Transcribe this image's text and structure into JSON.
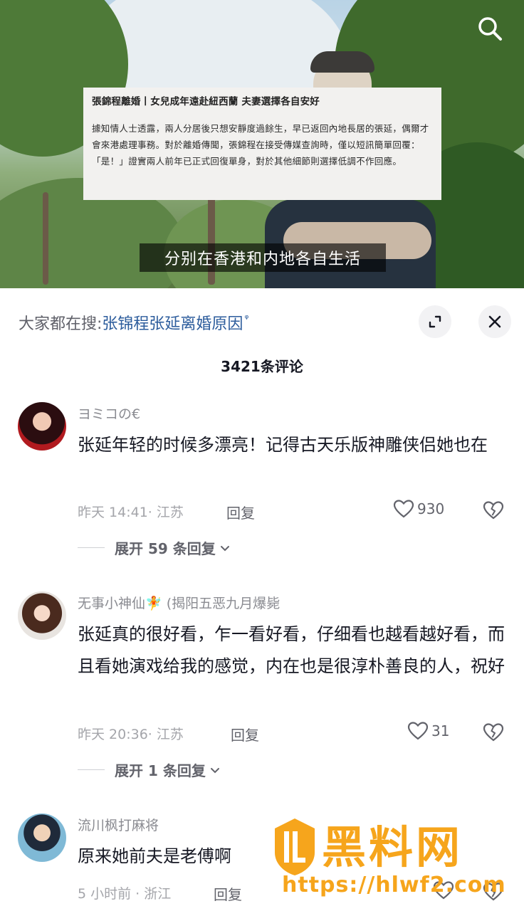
{
  "video": {
    "news_card": {
      "title": "張錦程離婚丨女兒成年遠赴紐西蘭  夫妻選擇各自安好",
      "body": "據知情人士透露，兩人分居後只想安靜度過餘生，早已返回內地長居的張延，偶爾才會來港處理事務。對於離婚傳聞，張錦程在接受傳媒查詢時，僅以短訊簡單回覆：「是！」證實兩人前年已正式回復單身，對於其他細節則選擇低調不作回應。"
    },
    "subtitle": "分别在香港和内地各自生活",
    "search_icon": "search-icon"
  },
  "sheet": {
    "hot_search_label": "大家都在搜:",
    "hot_search_query": "张锦程张延离婚原因",
    "hot_search_glyph": "ᵠ",
    "comment_count": "3421条评论",
    "expand_icon": "expand-icon",
    "close_icon": "close-icon"
  },
  "comments": [
    {
      "user": "ヨミコの€",
      "text": "张延年轻的时候多漂亮！记得古天乐版神雕侠侣她也在",
      "meta": "昨天 14:41· 江苏",
      "reply": "回复",
      "likes": "930",
      "expand": "展开 59 条回复"
    },
    {
      "user": "无事小神仙🧚 (揭阳五恶九月爆毙",
      "text": "张延真的很好看，乍一看好看，仔细看也越看越好看，而且看她演戏给我的感觉，内在也是很淳朴善良的人，祝好",
      "meta": "昨天 20:36· 江苏",
      "reply": "回复",
      "likes": "31",
      "expand": "展开 1 条回复"
    },
    {
      "user": "流川枫打麻将",
      "text": "原来她前夫是老傅啊",
      "meta": "5 小时前 · 浙江",
      "reply": "回复"
    }
  ],
  "watermark": {
    "title": "黑料网",
    "url": "https://hlwf2.com"
  },
  "colors": {
    "link": "#2c5c9c",
    "watermark": "#f6a51c"
  }
}
